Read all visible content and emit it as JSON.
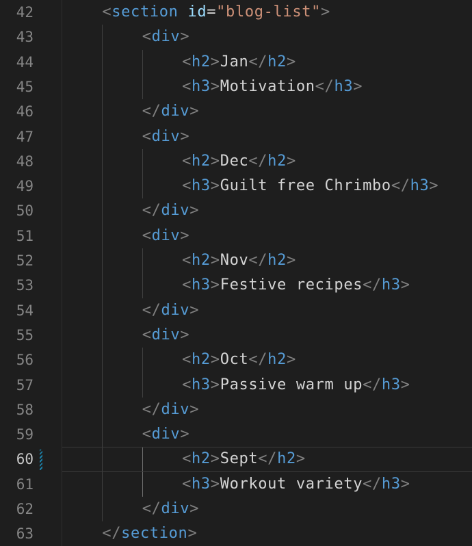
{
  "editor": {
    "colors": {
      "background": "#1e1e1e",
      "line_number": "#858585",
      "tag": "#569cd6",
      "bracket": "#808080",
      "attribute": "#9cdcfe",
      "string": "#ce9178",
      "text": "#d4d4d4",
      "modified_marker": "#1b81a8"
    },
    "current_line": 60,
    "lines": [
      {
        "n": "42",
        "indent": 1,
        "tokens": [
          [
            "punct",
            "<"
          ],
          [
            "tag",
            "section"
          ],
          [
            "text",
            " "
          ],
          [
            "attr",
            "id"
          ],
          [
            "eq",
            "="
          ],
          [
            "str",
            "\"blog-list\""
          ],
          [
            "punct",
            ">"
          ]
        ]
      },
      {
        "n": "43",
        "indent": 2,
        "tokens": [
          [
            "punct",
            "<"
          ],
          [
            "tag",
            "div"
          ],
          [
            "punct",
            ">"
          ]
        ]
      },
      {
        "n": "44",
        "indent": 3,
        "tokens": [
          [
            "punct",
            "<"
          ],
          [
            "tag",
            "h2"
          ],
          [
            "punct",
            ">"
          ],
          [
            "text",
            "Jan"
          ],
          [
            "punct",
            "</"
          ],
          [
            "tag",
            "h2"
          ],
          [
            "punct",
            ">"
          ]
        ]
      },
      {
        "n": "45",
        "indent": 3,
        "tokens": [
          [
            "punct",
            "<"
          ],
          [
            "tag",
            "h3"
          ],
          [
            "punct",
            ">"
          ],
          [
            "text",
            "Motivation"
          ],
          [
            "punct",
            "</"
          ],
          [
            "tag",
            "h3"
          ],
          [
            "punct",
            ">"
          ]
        ]
      },
      {
        "n": "46",
        "indent": 2,
        "tokens": [
          [
            "punct",
            "</"
          ],
          [
            "tag",
            "div"
          ],
          [
            "punct",
            ">"
          ]
        ]
      },
      {
        "n": "47",
        "indent": 2,
        "tokens": [
          [
            "punct",
            "<"
          ],
          [
            "tag",
            "div"
          ],
          [
            "punct",
            ">"
          ]
        ]
      },
      {
        "n": "48",
        "indent": 3,
        "tokens": [
          [
            "punct",
            "<"
          ],
          [
            "tag",
            "h2"
          ],
          [
            "punct",
            ">"
          ],
          [
            "text",
            "Dec"
          ],
          [
            "punct",
            "</"
          ],
          [
            "tag",
            "h2"
          ],
          [
            "punct",
            ">"
          ]
        ]
      },
      {
        "n": "49",
        "indent": 3,
        "tokens": [
          [
            "punct",
            "<"
          ],
          [
            "tag",
            "h3"
          ],
          [
            "punct",
            ">"
          ],
          [
            "text",
            "Guilt free Chrimbo"
          ],
          [
            "punct",
            "</"
          ],
          [
            "tag",
            "h3"
          ],
          [
            "punct",
            ">"
          ]
        ]
      },
      {
        "n": "50",
        "indent": 2,
        "tokens": [
          [
            "punct",
            "</"
          ],
          [
            "tag",
            "div"
          ],
          [
            "punct",
            ">"
          ]
        ]
      },
      {
        "n": "51",
        "indent": 2,
        "tokens": [
          [
            "punct",
            "<"
          ],
          [
            "tag",
            "div"
          ],
          [
            "punct",
            ">"
          ]
        ]
      },
      {
        "n": "52",
        "indent": 3,
        "tokens": [
          [
            "punct",
            "<"
          ],
          [
            "tag",
            "h2"
          ],
          [
            "punct",
            ">"
          ],
          [
            "text",
            "Nov"
          ],
          [
            "punct",
            "</"
          ],
          [
            "tag",
            "h2"
          ],
          [
            "punct",
            ">"
          ]
        ]
      },
      {
        "n": "53",
        "indent": 3,
        "tokens": [
          [
            "punct",
            "<"
          ],
          [
            "tag",
            "h3"
          ],
          [
            "punct",
            ">"
          ],
          [
            "text",
            "Festive recipes"
          ],
          [
            "punct",
            "</"
          ],
          [
            "tag",
            "h3"
          ],
          [
            "punct",
            ">"
          ]
        ]
      },
      {
        "n": "54",
        "indent": 2,
        "tokens": [
          [
            "punct",
            "</"
          ],
          [
            "tag",
            "div"
          ],
          [
            "punct",
            ">"
          ]
        ]
      },
      {
        "n": "55",
        "indent": 2,
        "tokens": [
          [
            "punct",
            "<"
          ],
          [
            "tag",
            "div"
          ],
          [
            "punct",
            ">"
          ]
        ]
      },
      {
        "n": "56",
        "indent": 3,
        "tokens": [
          [
            "punct",
            "<"
          ],
          [
            "tag",
            "h2"
          ],
          [
            "punct",
            ">"
          ],
          [
            "text",
            "Oct"
          ],
          [
            "punct",
            "</"
          ],
          [
            "tag",
            "h2"
          ],
          [
            "punct",
            ">"
          ]
        ]
      },
      {
        "n": "57",
        "indent": 3,
        "tokens": [
          [
            "punct",
            "<"
          ],
          [
            "tag",
            "h3"
          ],
          [
            "punct",
            ">"
          ],
          [
            "text",
            "Passive warm up"
          ],
          [
            "punct",
            "</"
          ],
          [
            "tag",
            "h3"
          ],
          [
            "punct",
            ">"
          ]
        ]
      },
      {
        "n": "58",
        "indent": 2,
        "tokens": [
          [
            "punct",
            "</"
          ],
          [
            "tag",
            "div"
          ],
          [
            "punct",
            ">"
          ]
        ]
      },
      {
        "n": "59",
        "indent": 2,
        "tokens": [
          [
            "punct",
            "<"
          ],
          [
            "tag",
            "div"
          ],
          [
            "punct",
            ">"
          ]
        ]
      },
      {
        "n": "60",
        "indent": 3,
        "tokens": [
          [
            "punct",
            "<"
          ],
          [
            "tag",
            "h2"
          ],
          [
            "punct",
            ">"
          ],
          [
            "text",
            "Sept"
          ],
          [
            "punct",
            "</"
          ],
          [
            "tag",
            "h2"
          ],
          [
            "punct",
            ">"
          ]
        ]
      },
      {
        "n": "61",
        "indent": 3,
        "tokens": [
          [
            "punct",
            "<"
          ],
          [
            "tag",
            "h3"
          ],
          [
            "punct",
            ">"
          ],
          [
            "text",
            "Workout variety"
          ],
          [
            "punct",
            "</"
          ],
          [
            "tag",
            "h3"
          ],
          [
            "punct",
            ">"
          ]
        ]
      },
      {
        "n": "62",
        "indent": 2,
        "tokens": [
          [
            "punct",
            "</"
          ],
          [
            "tag",
            "div"
          ],
          [
            "punct",
            ">"
          ]
        ]
      },
      {
        "n": "63",
        "indent": 1,
        "tokens": [
          [
            "punct",
            "</"
          ],
          [
            "tag",
            "section"
          ],
          [
            "punct",
            ">"
          ]
        ]
      }
    ]
  }
}
